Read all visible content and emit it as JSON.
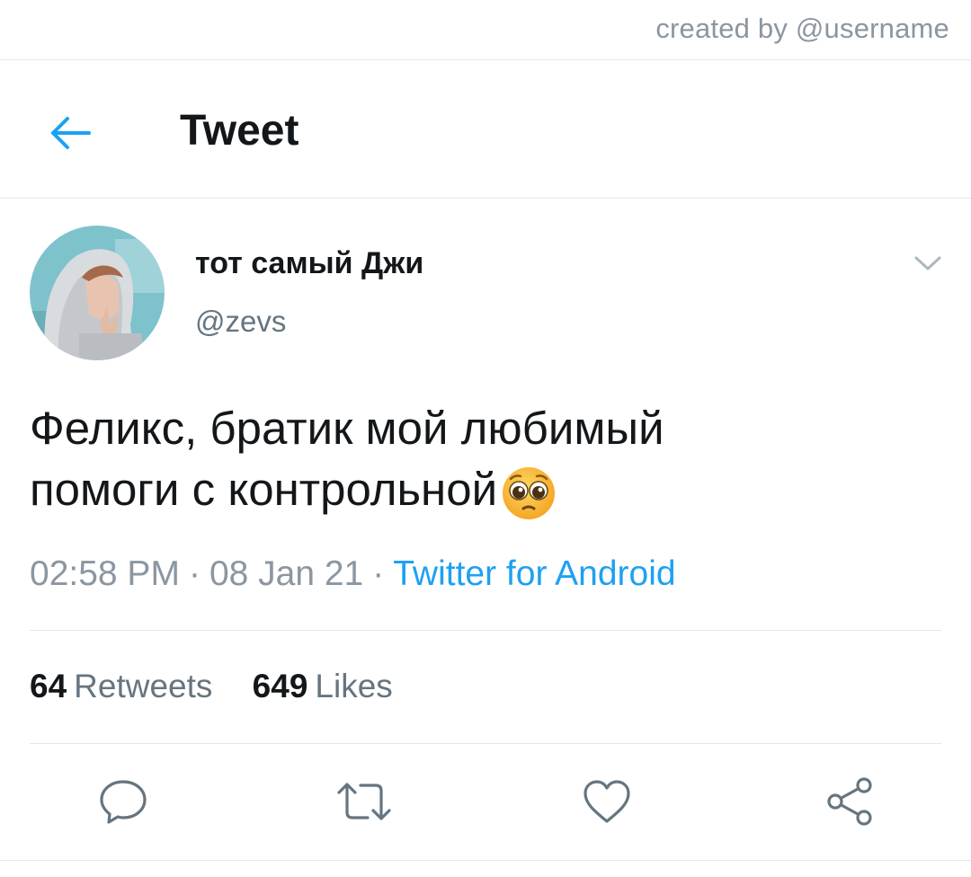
{
  "watermark": "created by @username",
  "header": {
    "title": "Tweet",
    "back_icon": "arrow-left-icon"
  },
  "tweet": {
    "display_name": "тот самый Джи",
    "handle": "@zevs",
    "text_line1": "Феликс, братик мой любимый",
    "text_line2": "помоги с контрольной",
    "emoji": "pleading-face-emoji",
    "time": "02:58 PM",
    "date": "08 Jan 21",
    "separator": "·",
    "source": "Twitter for Android"
  },
  "stats": {
    "retweets_count": "64",
    "retweets_label": "Retweets",
    "likes_count": "649",
    "likes_label": "Likes"
  },
  "actions": [
    "reply-icon",
    "retweet-icon",
    "like-icon",
    "share-icon"
  ],
  "colors": {
    "accent": "#1da1f2",
    "text": "#14171a",
    "muted": "#8b96a1",
    "divider": "#e4e8eb"
  }
}
